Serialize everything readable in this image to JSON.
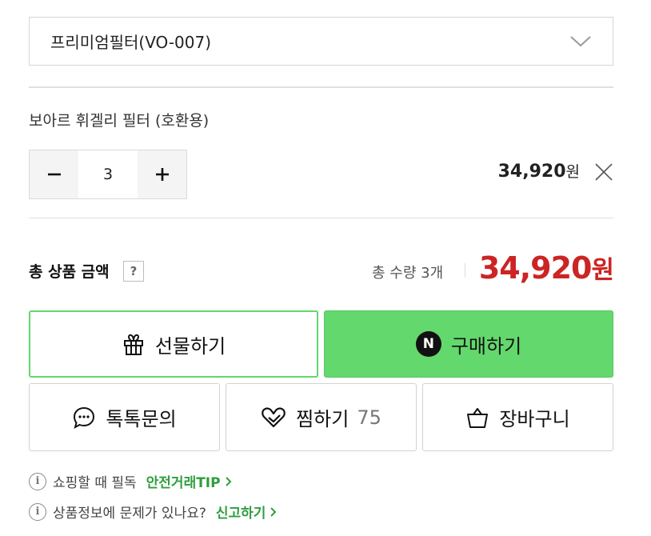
{
  "option_select": {
    "value": "프리미엄필터(VO-007)"
  },
  "selected_item": {
    "name": "보아르 휘겔리 필터 (호환용)",
    "quantity": "3",
    "price": "34,920",
    "price_unit": "원"
  },
  "summary": {
    "label": "총 상품 금액",
    "help": "?",
    "quantity_text": "총 수량 3개",
    "total": "34,920",
    "total_unit": "원"
  },
  "actions": {
    "gift_label": "선물하기",
    "buy_badge": "N",
    "buy_label": "구매하기",
    "talk_label": "톡톡문의",
    "zzim_label": "찜하기",
    "zzim_count": "75",
    "cart_label": "장바구니"
  },
  "notices": {
    "safety_text": "쇼핑할 때 필독",
    "safety_link": "안전거래TIP",
    "report_text": "상품정보에 문제가 있나요?",
    "report_link": "신고하기",
    "info_glyph": "i"
  },
  "colors": {
    "accent_green": "#63d86d",
    "price_red": "#cc2424",
    "link_green": "#2e9e3e"
  }
}
